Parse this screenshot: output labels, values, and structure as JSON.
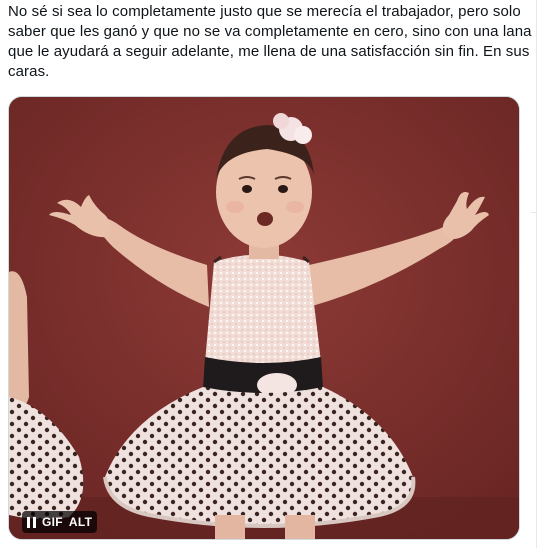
{
  "tweet": {
    "text": "No sé si sea lo completamente justo que se merecía el trabajador, pero solo saber que les ganó y que no se va completamente en cero, sino con una lana que le ayudará a seguir adelante, me llena de una satisfacción sin fin. En sus caras."
  },
  "media": {
    "type": "gif",
    "subject": "girl-dancer-shrugging",
    "controls": {
      "pause_icon": "pause-icon",
      "gif_label": "GIF",
      "alt_label": "ALT"
    }
  },
  "colors": {
    "text": "#0f1419",
    "backdrop": "#7a2f2c",
    "badge_bg": "#000000"
  }
}
